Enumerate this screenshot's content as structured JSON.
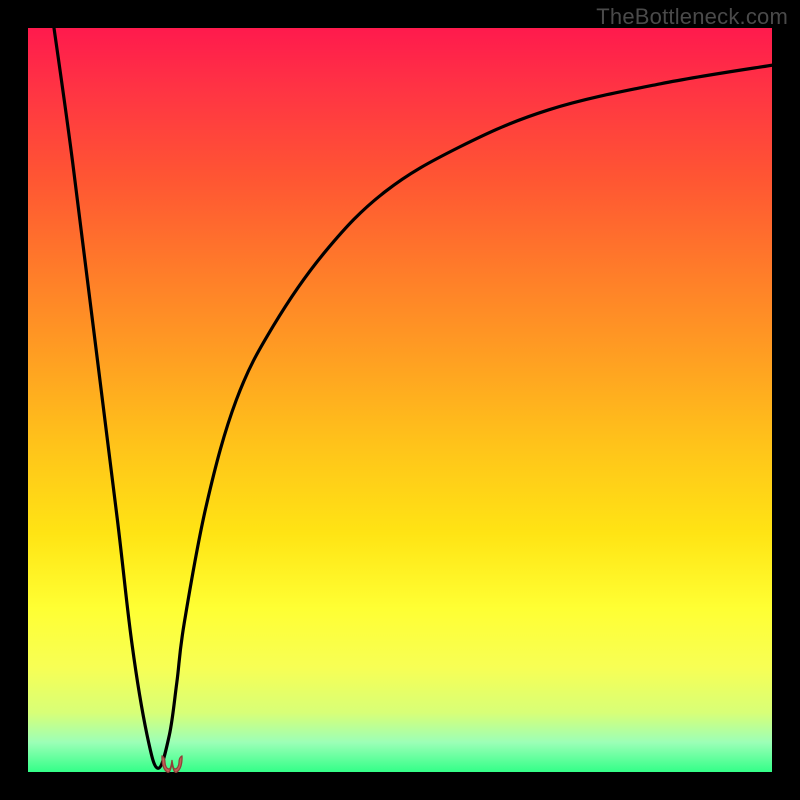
{
  "watermark": "TheBottleneck.com",
  "marker": {
    "name": "minimum-marker",
    "color": "#c16058"
  },
  "chart_data": {
    "type": "line",
    "title": "",
    "xlabel": "",
    "ylabel": "",
    "xlim": [
      0,
      100
    ],
    "ylim": [
      0,
      100
    ],
    "grid": false,
    "legend": false,
    "series": [
      {
        "name": "bottleneck-curve",
        "x": [
          3.5,
          6,
          9,
          12,
          14,
          16,
          17.5,
          19,
          20,
          21,
          24,
          28,
          33,
          40,
          48,
          58,
          70,
          85,
          100
        ],
        "y": [
          100,
          82,
          58,
          34,
          17,
          5,
          0.5,
          5,
          12,
          20,
          36,
          50,
          60,
          70,
          78,
          84,
          89,
          92.5,
          95
        ]
      }
    ],
    "annotations": [
      {
        "type": "marker",
        "x": 17.5,
        "y": 0.5,
        "label": "u-shape minimum"
      }
    ],
    "background_gradient": {
      "orientation": "vertical",
      "stops": [
        {
          "pos": 0.0,
          "color": "#ff1a4d"
        },
        {
          "pos": 0.5,
          "color": "#ffc31a"
        },
        {
          "pos": 0.8,
          "color": "#ffff33"
        },
        {
          "pos": 1.0,
          "color": "#33ff88"
        }
      ]
    }
  }
}
